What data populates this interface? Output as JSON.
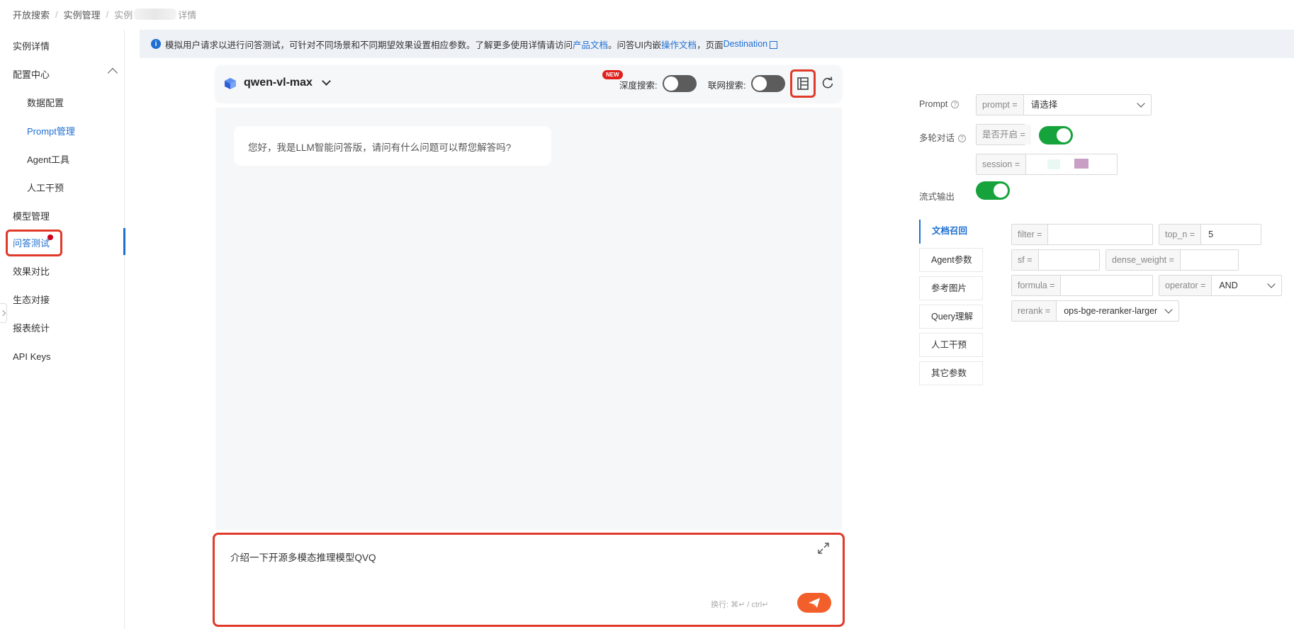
{
  "breadcrumb": {
    "item1": "开放搜索",
    "item2": "实例管理",
    "item3_prefix": "实例",
    "item3_suffix": "详情"
  },
  "nav": {
    "instance_detail": "实例详情",
    "config_center": "配置中心",
    "data_config": "数据配置",
    "prompt_mgmt": "Prompt管理",
    "agent_tools": "Agent工具",
    "human_intervention": "人工干预",
    "model_mgmt": "模型管理",
    "qa_test": "问答测试",
    "effect_compare": "效果对比",
    "ecosystem": "生态对接",
    "reports": "报表统计",
    "api_keys": "API Keys"
  },
  "info": {
    "text": "模拟用户请求以进行问答测试，可针对不同场景和不同期望效果设置相应参数。了解更多使用详情请访问 ",
    "link1": "产品文档",
    "text2": "。问答UI内嵌",
    "link2": "操作文档",
    "text3": "，页面",
    "link3": "Destination"
  },
  "chat": {
    "model": "qwen-vl-max",
    "new_badge": "NEW",
    "deep_search_label": "深度搜索:",
    "web_search_label": "联网搜索:",
    "greeting": "您好，我是LLM智能问答版，请问有什么问题可以帮您解答吗?",
    "input_value": "介绍一下开源多模态推理模型QVQ",
    "hint": "换行: ⌘↵ / ctrl↵"
  },
  "params": {
    "prompt_label": "Prompt",
    "prompt_key": "prompt =",
    "prompt_value": "请选择",
    "multiturn_label": "多轮对话",
    "enable_key": "是否开启 =",
    "session_key": "session =",
    "stream_label": "流式输出",
    "tabs": [
      "文档召回",
      "Agent参数",
      "参考图片",
      "Query理解",
      "人工干预",
      "其它参数"
    ],
    "filter_key": "filter =",
    "filter_value": "",
    "topn_key": "top_n =",
    "topn_value": "5",
    "sf_key": "sf =",
    "sf_value": "",
    "dense_key": "dense_weight =",
    "dense_value": "",
    "formula_key": "formula =",
    "formula_value": "",
    "operator_key": "operator =",
    "operator_value": "AND",
    "rerank_key": "rerank =",
    "rerank_value": "ops-bge-reranker-larger"
  },
  "colors": {
    "accent": "#1f6fd1",
    "highlight": "#e03a2a",
    "toggle_on": "#16a33b",
    "send": "#f25f2a"
  }
}
